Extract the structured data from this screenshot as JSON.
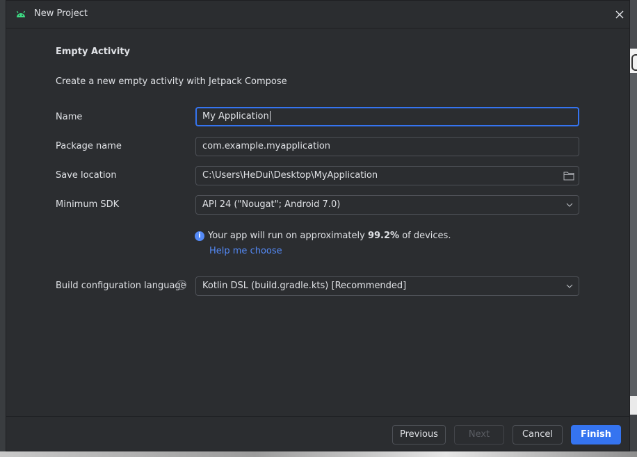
{
  "window": {
    "title": "New Project"
  },
  "form": {
    "heading": "Empty Activity",
    "description": "Create a new empty activity with Jetpack Compose",
    "name": {
      "label": "Name",
      "value": "My Application"
    },
    "package": {
      "label": "Package name",
      "value": "com.example.myapplication"
    },
    "save_location": {
      "label": "Save location",
      "value": "C:\\Users\\HeDui\\Desktop\\MyApplication"
    },
    "min_sdk": {
      "label": "Minimum SDK",
      "value": "API 24 (\"Nougat\"; Android 7.0)"
    },
    "info": {
      "prefix": "Your app will run on approximately",
      "percent": "99.2%",
      "suffix": "of devices.",
      "help_link": "Help me choose"
    },
    "build_lang": {
      "label": "Build configuration language",
      "value": "Kotlin DSL (build.gradle.kts) [Recommended]"
    }
  },
  "footer": {
    "previous": "Previous",
    "next": "Next",
    "cancel": "Cancel",
    "finish": "Finish"
  },
  "colors": {
    "accent": "#3574f0",
    "link": "#548af7",
    "dialog_bg": "#2b2d30",
    "android_green": "#3ddc84"
  },
  "icons": [
    "android-icon",
    "close-icon",
    "folder-icon",
    "info-icon",
    "question-icon",
    "chevron-down-icon"
  ]
}
